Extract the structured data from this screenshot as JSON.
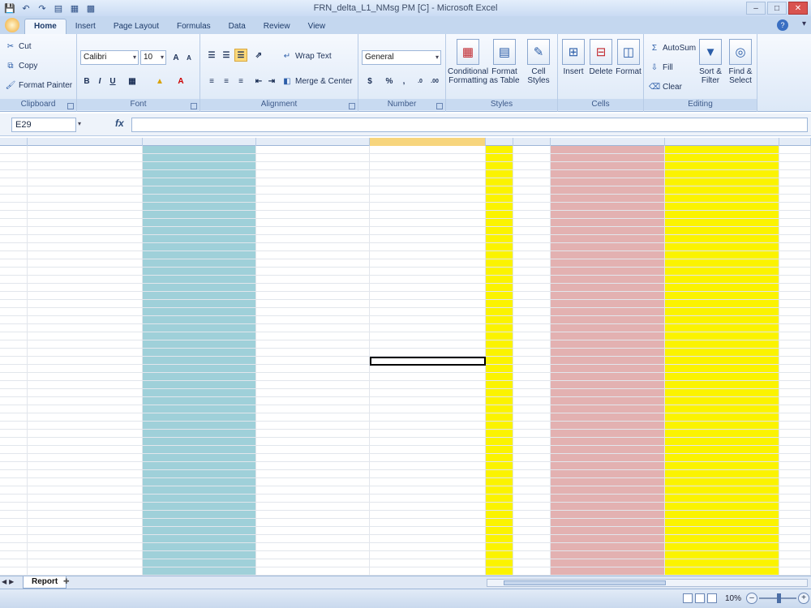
{
  "window": {
    "title": "FRN_delta_L1_NMsg PM [C] - Microsoft Excel"
  },
  "tabs": [
    {
      "label": "Home",
      "active": true
    },
    {
      "label": "Insert"
    },
    {
      "label": "Page Layout"
    },
    {
      "label": "Formulas"
    },
    {
      "label": "Data"
    },
    {
      "label": "Review"
    },
    {
      "label": "View"
    }
  ],
  "ribbon": {
    "clipboard": {
      "label": "Clipboard",
      "cut": "Cut",
      "copy": "Copy",
      "format_painter": "Format Painter"
    },
    "font": {
      "label": "Font",
      "name": "Calibri",
      "size": "10"
    },
    "alignment": {
      "label": "Alignment",
      "wrap_text": "Wrap Text",
      "merge_center": "Merge & Center"
    },
    "number": {
      "label": "Number",
      "format": "General"
    },
    "styles": {
      "label": "Styles",
      "conditional": "Conditional Formatting",
      "format_table": "Format as Table",
      "cell_styles": "Cell Styles"
    },
    "cells": {
      "label": "Cells",
      "insert": "Insert",
      "delete": "Delete",
      "format": "Format"
    },
    "editing": {
      "label": "Editing",
      "autosum": "AutoSum",
      "fill": "Fill",
      "clear": "Clear",
      "sort_filter": "Sort & Filter",
      "find_select": "Find & Select"
    }
  },
  "formula_bar": {
    "name_box": "E29",
    "fx": "fx",
    "value": ""
  },
  "sheet": {
    "tab": "Report",
    "selected_column": "E"
  },
  "status": {
    "zoom": "10%"
  },
  "colors": {
    "blue_band": "#9fd0d9",
    "yellow_band": "#fbf300",
    "pink_band": "#e3b1b1"
  }
}
